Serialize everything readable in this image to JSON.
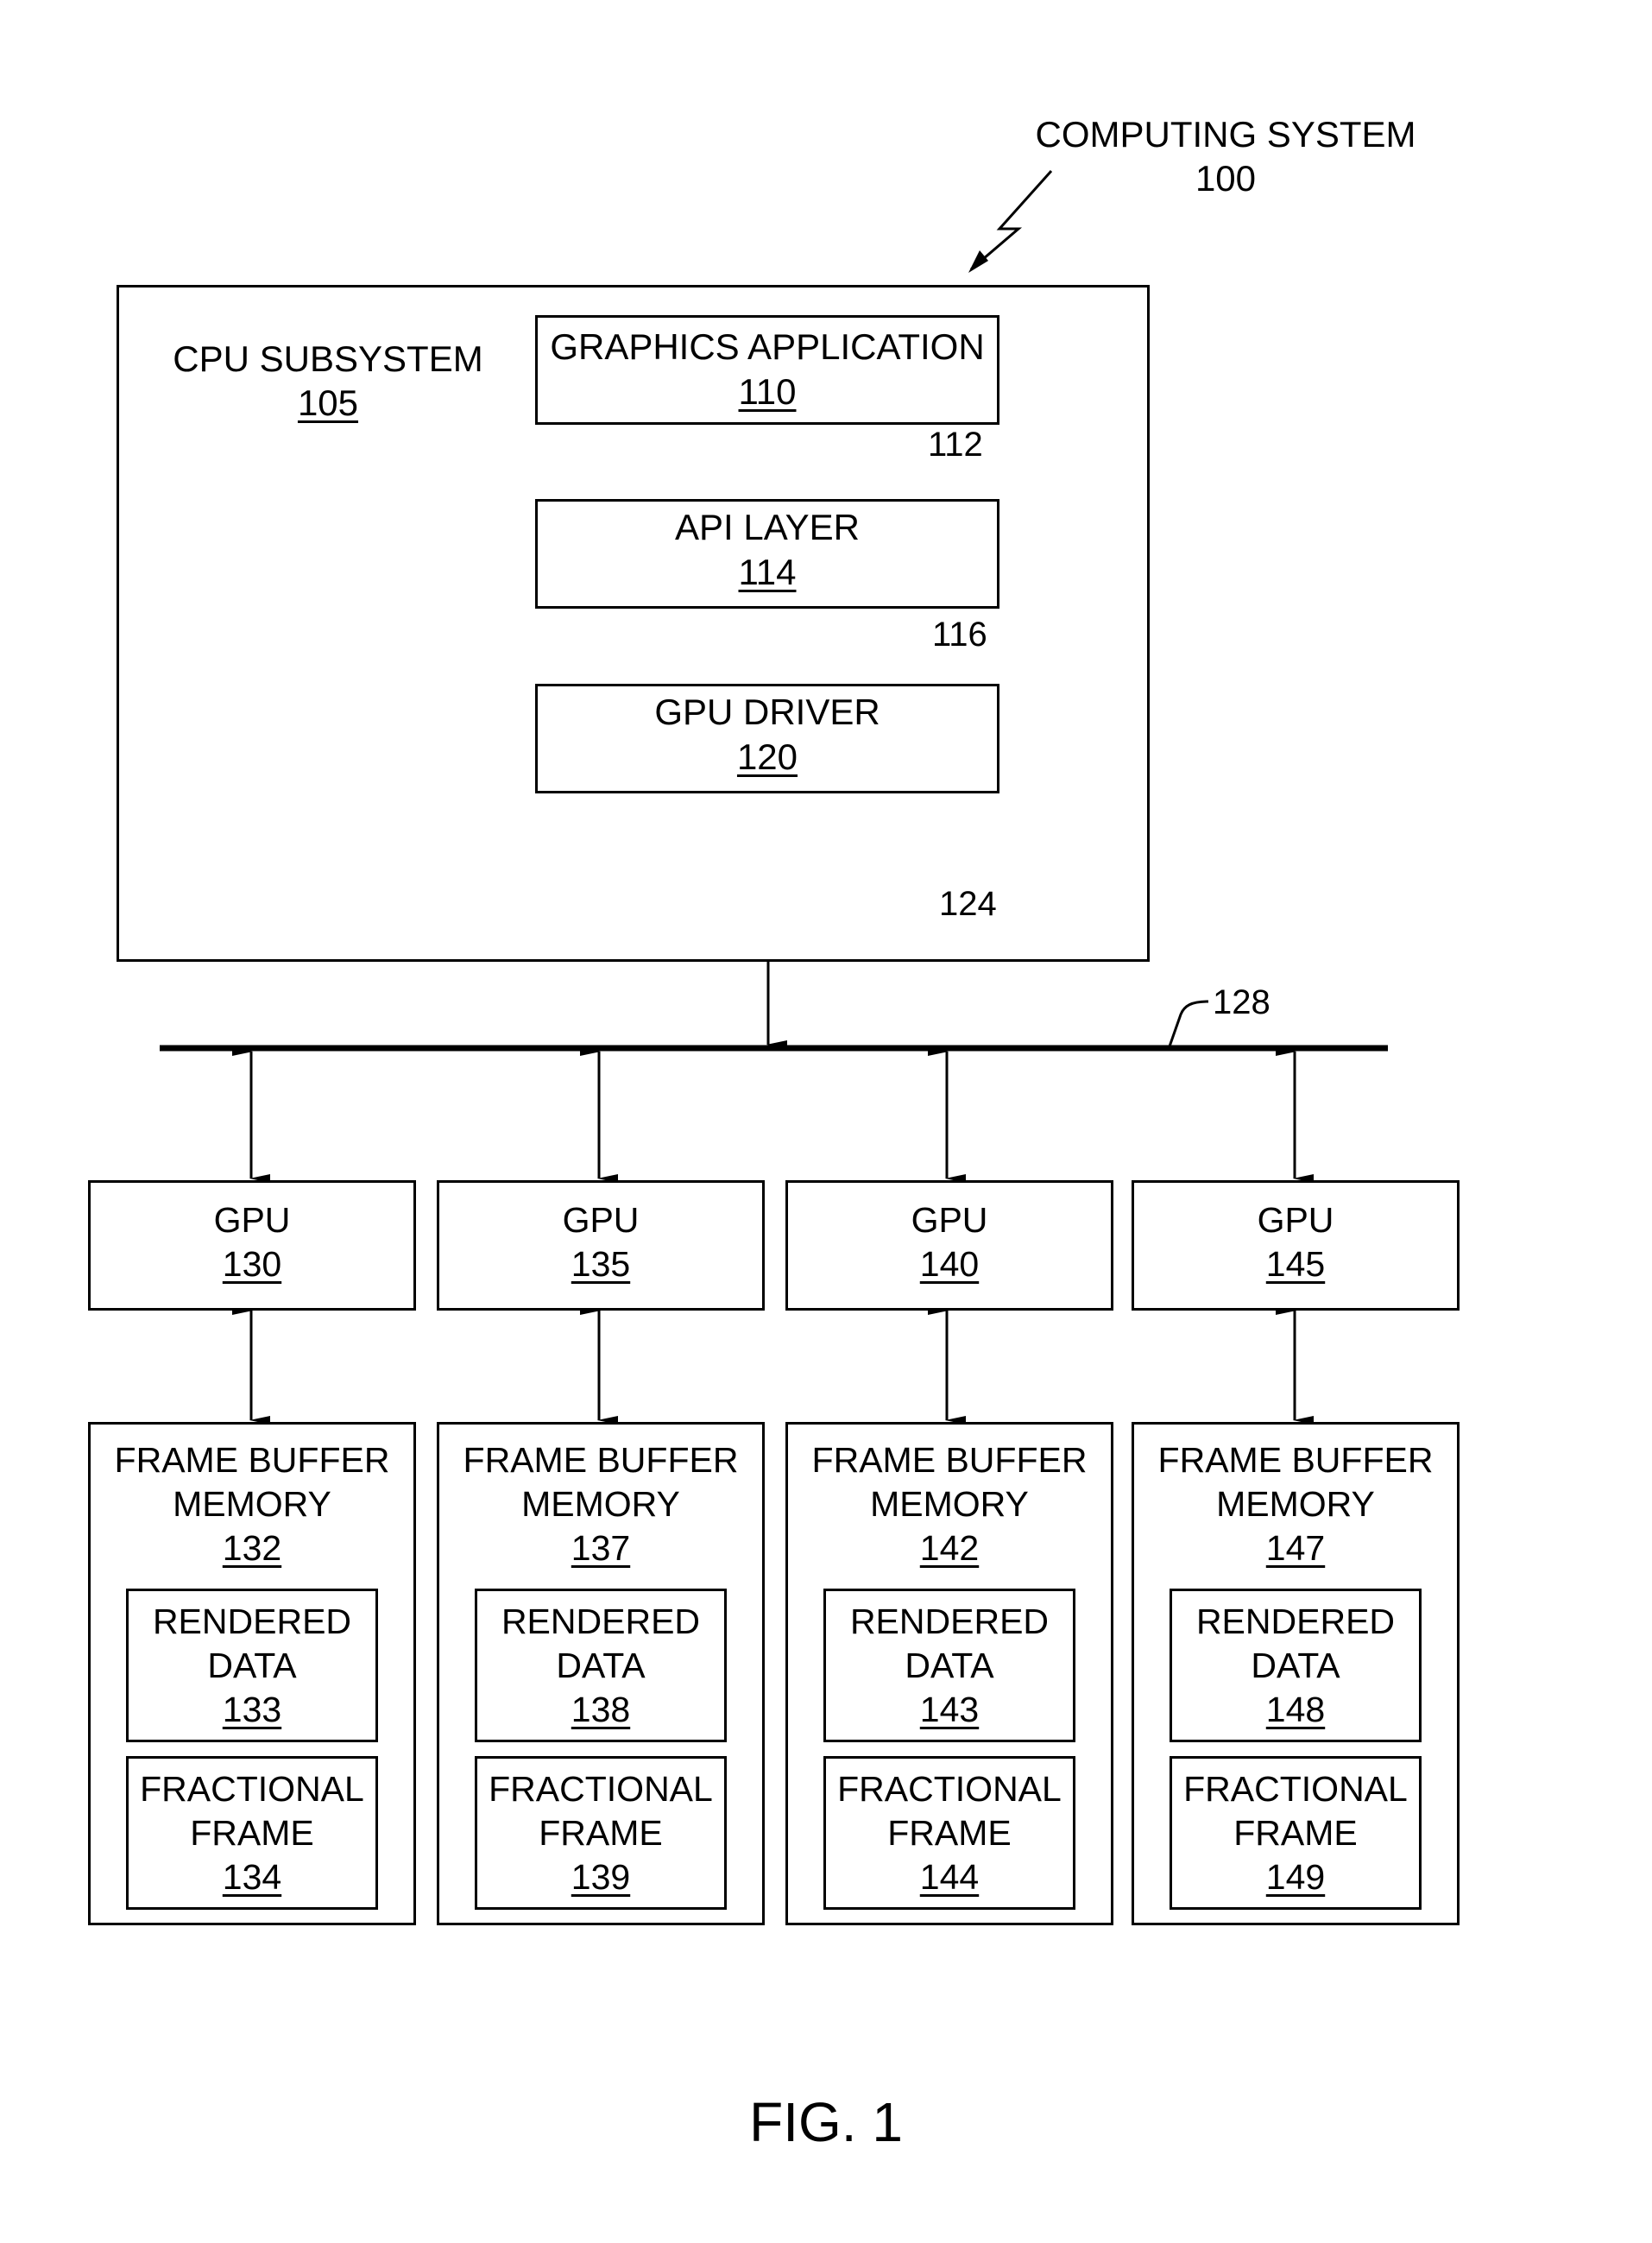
{
  "system": {
    "label": "COMPUTING SYSTEM",
    "ref": "100"
  },
  "cpu_subsystem": {
    "label": "CPU SUBSYSTEM",
    "ref": "105"
  },
  "graphics_app": {
    "label": "GRAPHICS APPLICATION",
    "ref": "110"
  },
  "api_layer": {
    "label": "API LAYER",
    "ref": "114"
  },
  "gpu_driver": {
    "label": "GPU DRIVER",
    "ref": "120"
  },
  "connections": {
    "app_to_api": "112",
    "api_to_driver": "116",
    "driver_to_bus": "124",
    "bus": "128"
  },
  "gpus": [
    {
      "label": "GPU",
      "ref": "130",
      "fb_label": "FRAME BUFFER\nMEMORY",
      "fb_ref": "132",
      "rd_label": "RENDERED\nDATA",
      "rd_ref": "133",
      "ff_label": "FRACTIONAL\nFRAME",
      "ff_ref": "134"
    },
    {
      "label": "GPU",
      "ref": "135",
      "fb_label": "FRAME BUFFER\nMEMORY",
      "fb_ref": "137",
      "rd_label": "RENDERED\nDATA",
      "rd_ref": "138",
      "ff_label": "FRACTIONAL\nFRAME",
      "ff_ref": "139"
    },
    {
      "label": "GPU",
      "ref": "140",
      "fb_label": "FRAME BUFFER\nMEMORY",
      "fb_ref": "142",
      "rd_label": "RENDERED\nDATA",
      "rd_ref": "143",
      "ff_label": "FRACTIONAL\nFRAME",
      "ff_ref": "144"
    },
    {
      "label": "GPU",
      "ref": "145",
      "fb_label": "FRAME BUFFER\nMEMORY",
      "fb_ref": "147",
      "rd_label": "RENDERED\nDATA",
      "rd_ref": "148",
      "ff_label": "FRACTIONAL\nFRAME",
      "ff_ref": "149"
    }
  ],
  "figure": {
    "caption": "FIG. 1"
  }
}
